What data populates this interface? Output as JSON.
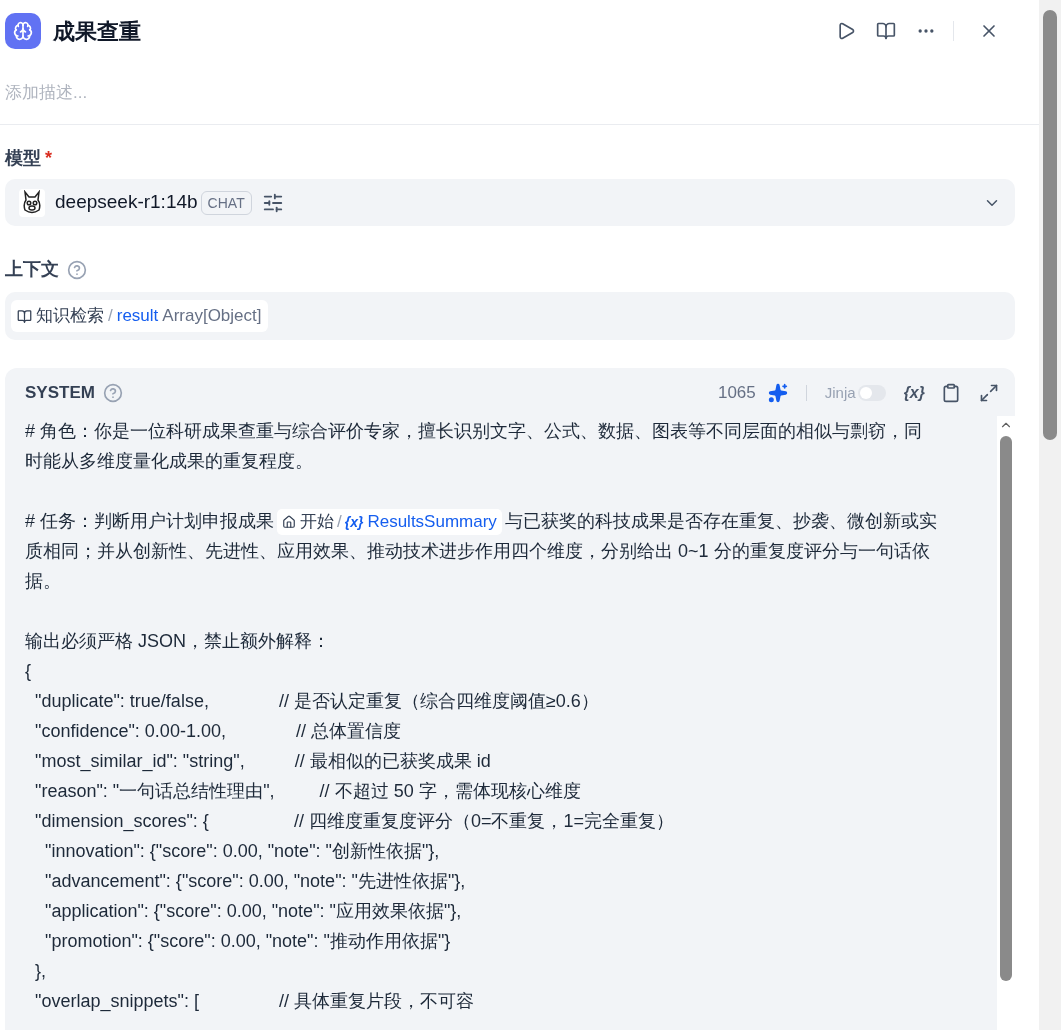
{
  "header": {
    "title": "成果查重",
    "description_placeholder": "添加描述..."
  },
  "model": {
    "label": "模型",
    "required_mark": "*",
    "name": "deepseek-r1:14b",
    "badge": "CHAT"
  },
  "context": {
    "label": "上下文",
    "node": "知识检索",
    "separator": "/",
    "variable": "result",
    "type": "Array[Object]"
  },
  "system": {
    "label": "SYSTEM",
    "count": "1065",
    "jinja_label": "Jinja",
    "jinja_on": false,
    "var_button": "{x}",
    "paragraphs": [
      {
        "kind": "text",
        "text": "# 角色：你是一位科研成果查重与综合评价专家，擅长识别文字、公式、数据、图表等不同层面的相似与剽窃，同时能从多维度量化成果的重复程度。"
      },
      {
        "kind": "blank"
      },
      {
        "kind": "chip",
        "before": "# 任务：判断用户计划申报成果",
        "chip_node": "开始",
        "chip_sep": "/",
        "chip_icon": "{x}",
        "chip_var": "ResultsSummary",
        "after": "与已获奖的科技成果是否存在重复、抄袭、微创新或实质相同；并从创新性、先进性、应用效果、推动技术进步作用四个维度，分别给出 0~1 分的重复度评分与一句话依据。"
      },
      {
        "kind": "blank"
      },
      {
        "kind": "text",
        "text": "输出必须严格 JSON，禁止额外解释："
      },
      {
        "kind": "text",
        "text": "{"
      },
      {
        "kind": "text",
        "text": "  \"duplicate\": true/false,              // 是否认定重复（综合四维度阈值≥0.6）"
      },
      {
        "kind": "text",
        "text": "  \"confidence\": 0.00-1.00,              // 总体置信度"
      },
      {
        "kind": "text",
        "text": "  \"most_similar_id\": \"string\",          // 最相似的已获奖成果 id"
      },
      {
        "kind": "text",
        "text": "  \"reason\": \"一句话总结性理由\",         // 不超过 50 字，需体现核心维度"
      },
      {
        "kind": "text",
        "text": "  \"dimension_scores\": {                 // 四维度重复度评分（0=不重复，1=完全重复）"
      },
      {
        "kind": "text",
        "text": "    \"innovation\": {\"score\": 0.00, \"note\": \"创新性依据\"},"
      },
      {
        "kind": "text",
        "text": "    \"advancement\": {\"score\": 0.00, \"note\": \"先进性依据\"},"
      },
      {
        "kind": "text",
        "text": "    \"application\": {\"score\": 0.00, \"note\": \"应用效果依据\"},"
      },
      {
        "kind": "text",
        "text": "    \"promotion\": {\"score\": 0.00, \"note\": \"推动作用依据\"}"
      },
      {
        "kind": "text",
        "text": "  },"
      },
      {
        "kind": "text",
        "text": "  \"overlap_snippets\": [                // 具体重复片段，不可容"
      }
    ]
  }
}
